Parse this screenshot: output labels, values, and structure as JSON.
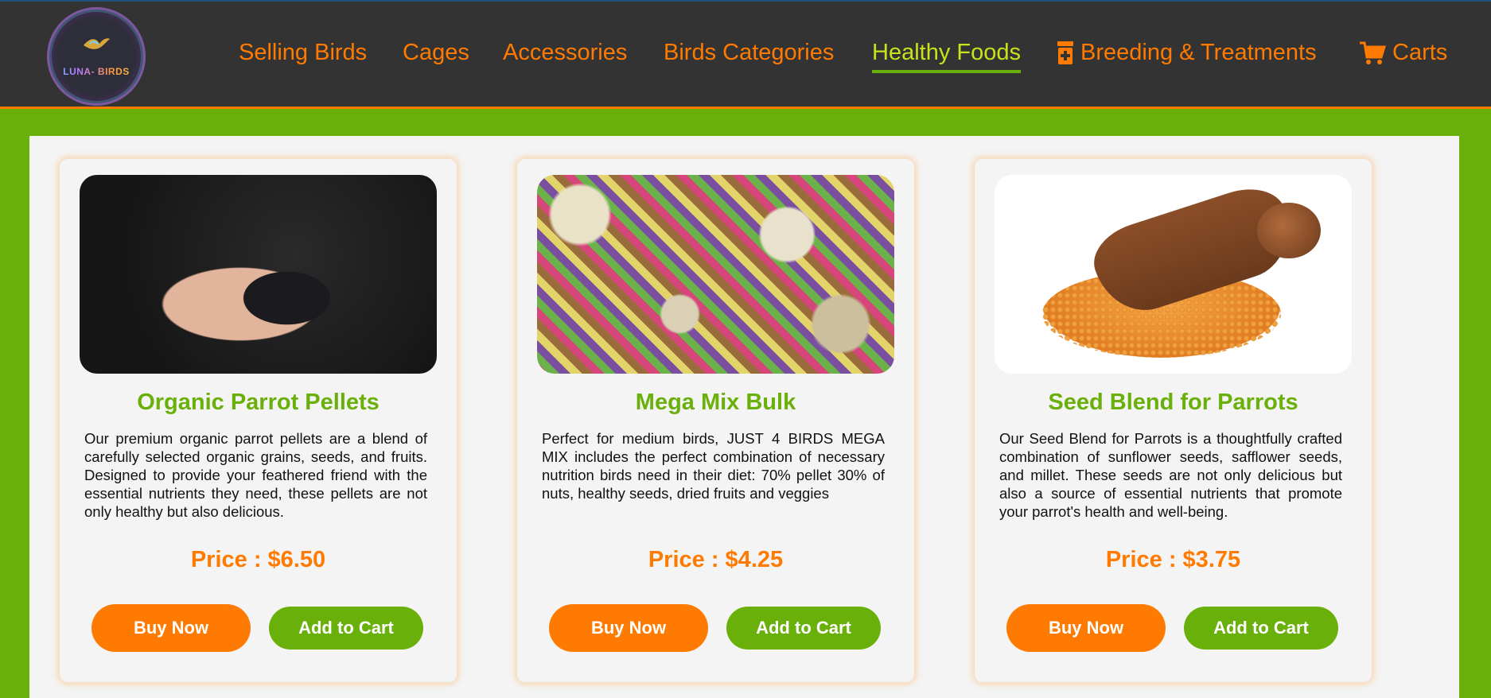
{
  "header": {
    "logo_text": "LUNA- BIRDS",
    "nav": [
      {
        "label": "Selling Birds",
        "active": false
      },
      {
        "label": "Cages",
        "active": false
      },
      {
        "label": "Accessories",
        "active": false
      },
      {
        "label": "Birds Categories",
        "active": false
      },
      {
        "label": "Healthy Foods",
        "active": true
      },
      {
        "label": "Breeding & Treatments",
        "active": false,
        "icon": "medicine-bottle-icon"
      },
      {
        "label": "Carts",
        "active": false,
        "icon": "cart-icon"
      }
    ]
  },
  "products": [
    {
      "title": "Organic Parrot Pellets",
      "description": "Our premium organic parrot pellets are a blend of carefully selected organic grains, seeds, and fruits. Designed to provide your feathered friend with the essential nutrients they need, these pellets are not only healthy but also delicious.",
      "price": "Price : $6.50",
      "buy_label": "Buy Now",
      "cart_label": "Add to Cart"
    },
    {
      "title": "Mega Mix Bulk",
      "description": "Perfect for medium birds, JUST 4 BIRDS MEGA MIX includes the perfect combination of necessary nutrition birds need in their diet: 70% pellet 30% of nuts, healthy seeds, dried fruits and veggies",
      "price": "Price : $4.25",
      "buy_label": "Buy Now",
      "cart_label": "Add to Cart"
    },
    {
      "title": "Seed Blend for Parrots",
      "description": "Our Seed Blend for Parrots is a thoughtfully crafted combination of sunflower seeds, safflower seeds, and millet. These seeds are not only delicious but also a source of essential nutrients that promote your parrot's health and well-being.",
      "price": "Price : $3.75",
      "buy_label": "Buy Now",
      "cart_label": "Add to Cart"
    }
  ],
  "colors": {
    "accent_orange": "#ff7a00",
    "accent_green": "#6ab00a",
    "active_nav": "#c8e21b",
    "header_bg": "#333333"
  }
}
